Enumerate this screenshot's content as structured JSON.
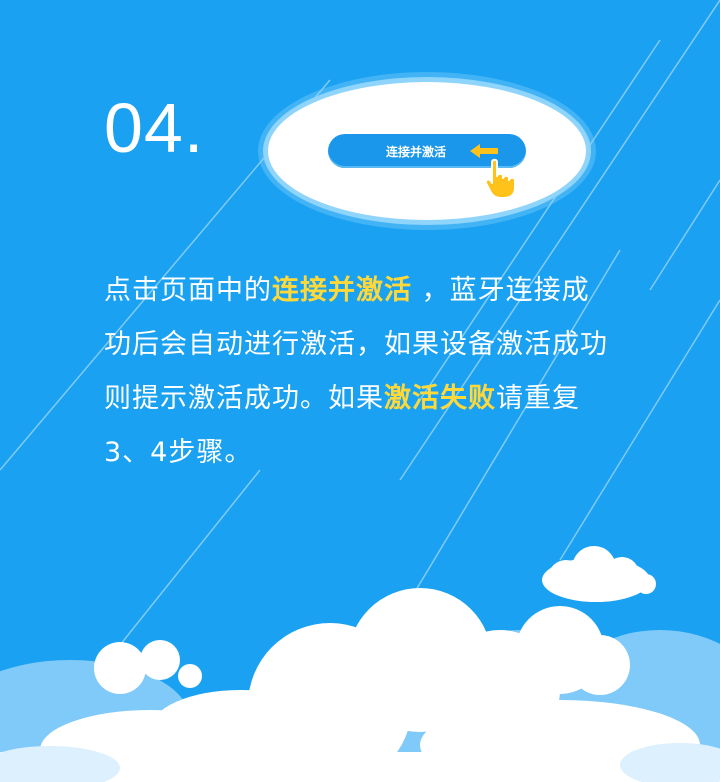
{
  "step": {
    "number": "04."
  },
  "demo": {
    "button_label": "连接并激活"
  },
  "description": {
    "part1": "点击页面中的",
    "highlight1": "连接并激活",
    "part2": "  ，蓝牙连接成功后会自动进行激活，如果设备激活成功则提示激活成功。如果",
    "highlight2": "激活失败",
    "part3": "请重复3、4步骤。"
  },
  "colors": {
    "background": "#1aa1f2",
    "highlight": "#ffd83a",
    "button": "#1a96ea",
    "arrow": "#ffc21a"
  },
  "icons": {
    "arrow": "arrow-left-icon",
    "hand": "pointing-hand-icon"
  }
}
